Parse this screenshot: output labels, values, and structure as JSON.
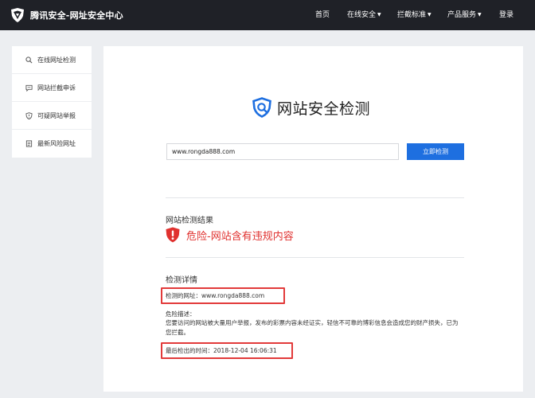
{
  "header": {
    "brand": "腾讯安全-网址安全中心",
    "nav": [
      {
        "label": "首页",
        "dropdown": false
      },
      {
        "label": "在线安全",
        "dropdown": true
      },
      {
        "label": "拦截标准",
        "dropdown": true
      },
      {
        "label": "产品服务",
        "dropdown": true
      },
      {
        "label": "登录",
        "dropdown": false
      }
    ],
    "caret": "▼"
  },
  "sidebar": {
    "items": [
      {
        "label": "在线网址检测",
        "icon": "search-icon"
      },
      {
        "label": "网站拦截申诉",
        "icon": "message-icon"
      },
      {
        "label": "可疑网站举报",
        "icon": "shield-icon"
      },
      {
        "label": "最新风险网址",
        "icon": "document-icon"
      }
    ]
  },
  "main": {
    "hero_title": "网站安全检测",
    "input_value": "www.rongda888.com",
    "check_button": "立即检测",
    "result": {
      "title": "网站检测结果",
      "status": "危险-网站含有违规内容"
    },
    "details": {
      "title": "检测详情",
      "url_label": "检测的网址：",
      "url_value": "www.rongda888.com",
      "desc_label": "危险描述：",
      "desc_text": "您要访问的网站被大量用户举报，发布的彩票内容未经证实，轻信不可靠的博彩信息会造成您的财产损失，已为您拦截。",
      "time_label": "最后检出的时间：",
      "time_value": "2018-12-04 16:06:31"
    }
  },
  "colors": {
    "topbar": "#1f2127",
    "accent": "#1e6fe0",
    "danger": "#e0312f",
    "highlight_box": "#e23a3a"
  }
}
